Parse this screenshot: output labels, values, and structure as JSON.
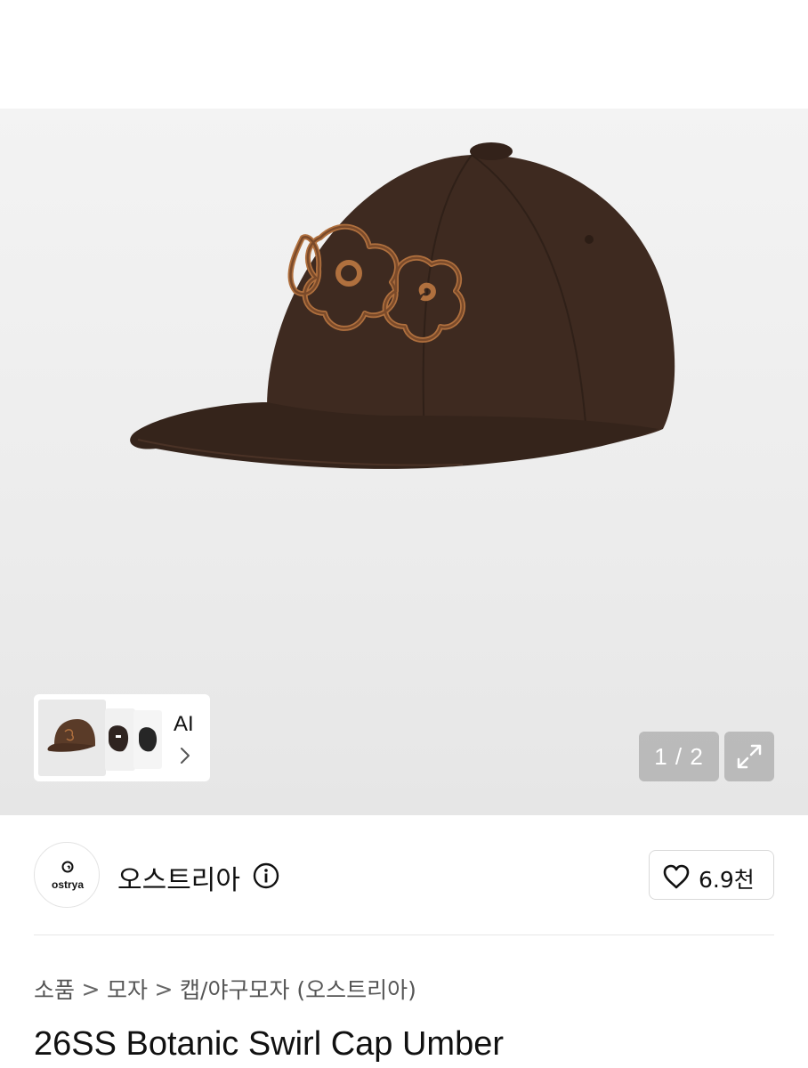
{
  "gallery": {
    "page_indicator": "1 / 2",
    "current_page": 1,
    "total_pages": 2,
    "ai_label": "AI",
    "product_color": "#3e2a20",
    "embroidery_color": "#b0703e",
    "expand_icon": "expand-arrows-icon",
    "chevron_icon": "chevron-right-icon"
  },
  "seller": {
    "logo_text": "ostrya",
    "name": "오스트리아",
    "info_icon": "info-icon",
    "like_icon": "heart-outline-icon",
    "like_count": "6.9천"
  },
  "breadcrumb": {
    "items": [
      "소품",
      "모자",
      "캡/야구모자 (오스트리아)"
    ],
    "separator": ">"
  },
  "product": {
    "title": "26SS Botanic Swirl Cap Umber"
  }
}
